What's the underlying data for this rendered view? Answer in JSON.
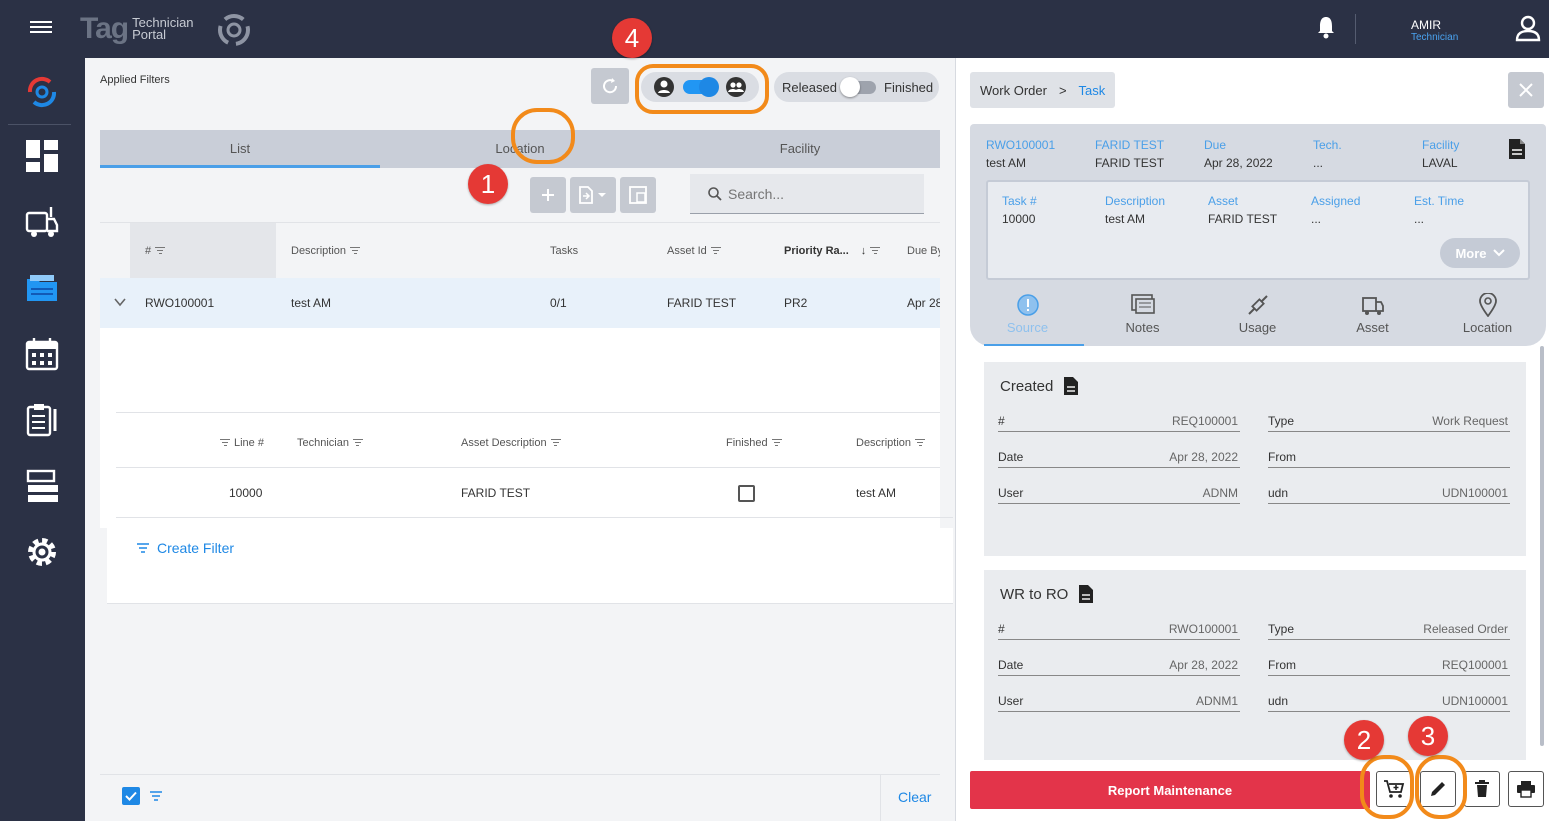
{
  "topbar": {
    "logo_tag": "Tag",
    "logo_line1": "Technician",
    "logo_line2": "Portal",
    "user_name": "AMIR",
    "user_role": "Technician"
  },
  "main": {
    "applied_filters": "Applied Filters",
    "release_toggle": {
      "left_label": "Released",
      "right_label": "Finished"
    },
    "tabs": [
      {
        "label": "List"
      },
      {
        "label": "Location"
      },
      {
        "label": "Facility"
      }
    ],
    "search_placeholder": "Search...",
    "columns": {
      "hash": "#",
      "description": "Description",
      "tasks": "Tasks",
      "asset_id": "Asset Id",
      "priority": "Priority Ra...",
      "due_by": "Due By"
    },
    "row": {
      "id": "RWO100001",
      "description": "test AM",
      "tasks": "0/1",
      "asset_id": "FARID TEST",
      "priority": "PR2",
      "due_by": "Apr 28"
    },
    "sub_columns": {
      "line": "Line #",
      "technician": "Technician",
      "asset_description": "Asset Description",
      "finished": "Finished",
      "description": "Description"
    },
    "sub_row": {
      "line": "10000",
      "technician": "",
      "asset_description": "FARID TEST",
      "description": "test AM"
    },
    "create_filter": "Create Filter",
    "clear": "Clear"
  },
  "badges": {
    "b1": "1",
    "b2": "2",
    "b3": "3",
    "b4": "4"
  },
  "panel": {
    "breadcrumb": {
      "parent": "Work Order",
      "sep": ">",
      "current": "Task"
    },
    "header": [
      {
        "key": "RWO100001",
        "value": "test AM"
      },
      {
        "key": "FARID TEST",
        "value": "FARID TEST"
      },
      {
        "key": "Due",
        "value": "Apr 28, 2022"
      },
      {
        "key": "Tech.",
        "value": "..."
      },
      {
        "key": "Facility",
        "value": "LAVAL"
      }
    ],
    "task": [
      {
        "key": "Task #",
        "value": "10000"
      },
      {
        "key": "Description",
        "value": "test AM"
      },
      {
        "key": "Asset",
        "value": "FARID TEST"
      },
      {
        "key": "Assigned",
        "value": "..."
      },
      {
        "key": "Est. Time",
        "value": "..."
      }
    ],
    "more": "More",
    "subtabs": [
      {
        "label": "Source"
      },
      {
        "label": "Notes"
      },
      {
        "label": "Usage"
      },
      {
        "label": "Asset"
      },
      {
        "label": "Location"
      }
    ],
    "cards": [
      {
        "title": "Created",
        "fields": [
          {
            "k": "#",
            "v": "REQ100001"
          },
          {
            "k": "Type",
            "v": "Work Request"
          },
          {
            "k": "Date",
            "v": "Apr 28, 2022"
          },
          {
            "k": "From",
            "v": ""
          },
          {
            "k": "User",
            "v": "ADNM"
          },
          {
            "k": "udn",
            "v": "UDN100001"
          }
        ]
      },
      {
        "title": "WR to RO",
        "fields": [
          {
            "k": "#",
            "v": "RWO100001"
          },
          {
            "k": "Type",
            "v": "Released Order"
          },
          {
            "k": "Date",
            "v": "Apr 28, 2022"
          },
          {
            "k": "From",
            "v": "REQ100001"
          },
          {
            "k": "User",
            "v": "ADNM1"
          },
          {
            "k": "udn",
            "v": "UDN100001"
          }
        ]
      }
    ],
    "report_button": "Report Maintenance"
  },
  "colors": {
    "nav_bg": "#2b3145",
    "accent": "#1e88e5",
    "report": "#e3344a",
    "highlight_ring": "#f28a1a",
    "badge": "#e53935"
  },
  "icons": [
    "menu-icon",
    "bell-icon",
    "user-icon",
    "dashboard-icon",
    "truck-icon",
    "folder-icon",
    "calendar-icon",
    "clipboard-icon",
    "list-icon",
    "gear-icon",
    "refresh-icon",
    "add-icon",
    "export-icon",
    "layout-icon",
    "search-icon",
    "filter-icon",
    "chevron-down-icon",
    "document-icon",
    "close-icon",
    "cart-icon",
    "edit-icon",
    "delete-icon",
    "print-icon"
  ]
}
